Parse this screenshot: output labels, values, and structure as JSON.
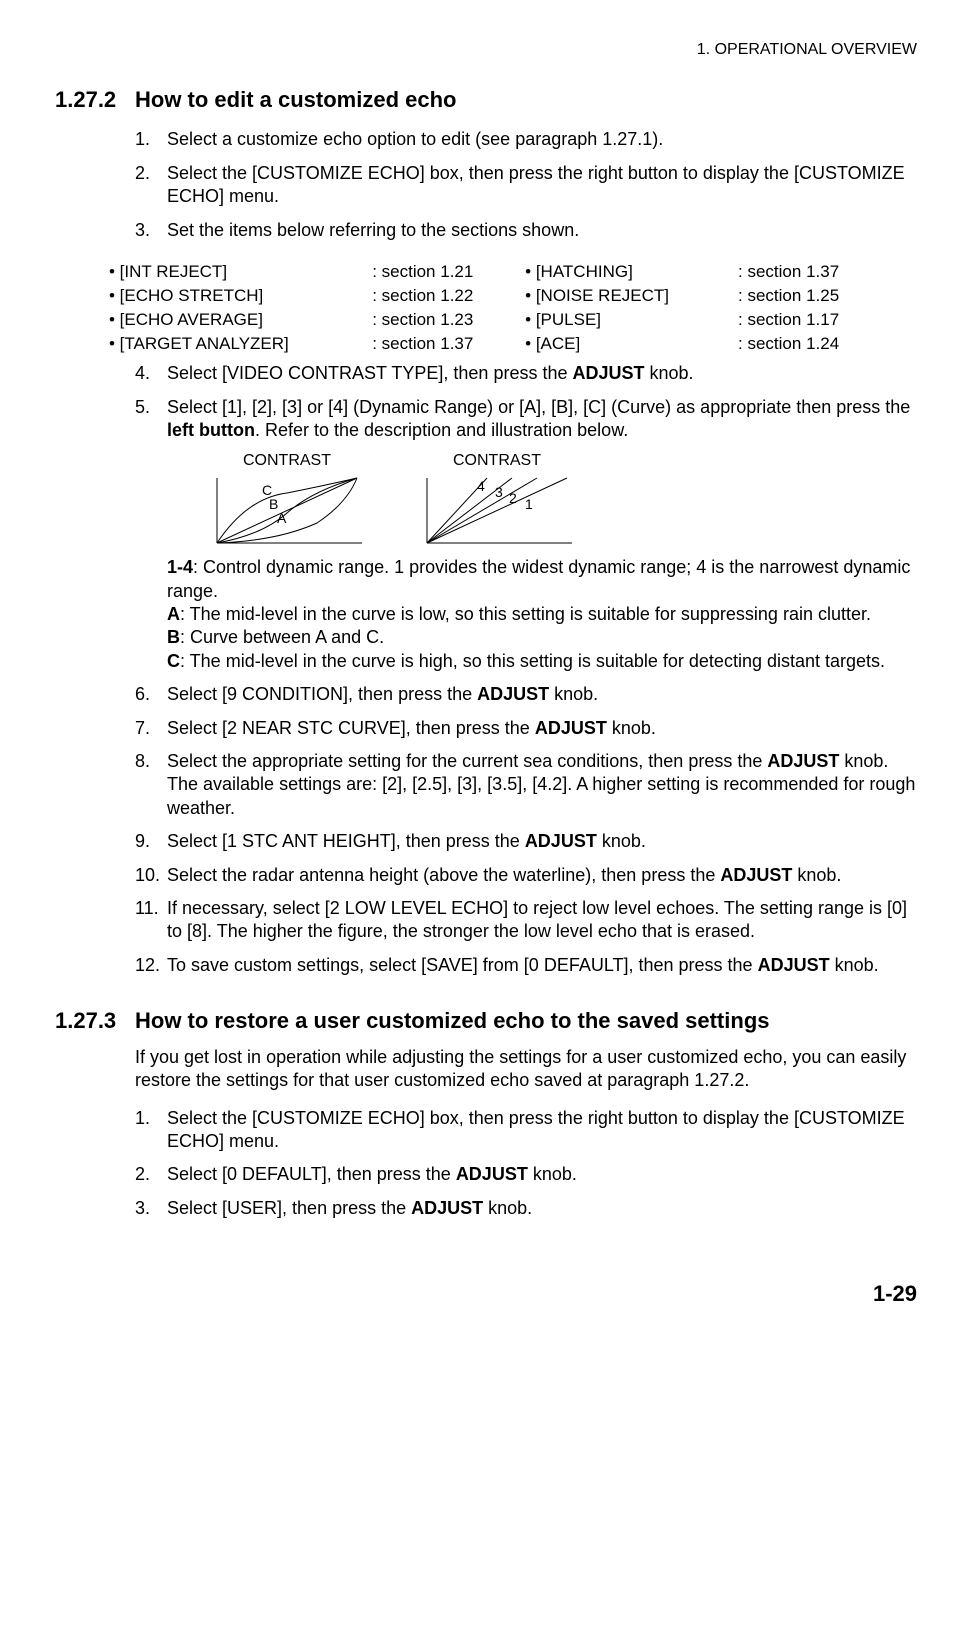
{
  "header": "1.  OPERATIONAL OVERVIEW",
  "s1": {
    "num": "1.27.2",
    "title": "How to edit a customized echo",
    "step1": "Select a customize echo option to edit (see paragraph 1.27.1).",
    "step2": "Select the [CUSTOMIZE ECHO] box, then press the right button to display the [CUSTOMIZE ECHO] menu.",
    "step3": "Set the items below referring to the sections shown.",
    "refs": {
      "l1a": "• [INT REJECT]",
      "l1b": ": section 1.21",
      "l1c": "• [HATCHING]",
      "l1d": ": section 1.37",
      "l2a": "• [ECHO STRETCH]",
      "l2b": ": section 1.22",
      "l2c": "• [NOISE REJECT]",
      "l2d": ": section 1.25",
      "l3a": "• [ECHO AVERAGE]",
      "l3b": ": section 1.23",
      "l3c": "• [PULSE]",
      "l3d": ": section 1.17",
      "l4a": "• [TARGET ANALYZER]",
      "l4b": ": section 1.37",
      "l4c": "• [ACE]",
      "l4d": ": section 1.24"
    },
    "step4a": "Select [VIDEO CONTRAST TYPE], then press the ",
    "step4b": "ADJUST",
    "step4c": " knob.",
    "step5a": "Select [1], [2], [3] or [4] (Dynamic Range) or [A], [B], [C] (Curve) as appropriate then press the ",
    "step5b": "left button",
    "step5c": ". Refer to the description and illustration below.",
    "diagLabel": "CONTRAST",
    "dA": "A",
    "dB": "B",
    "dC": "C",
    "d1": "1",
    "d2": "2",
    "d3": "3",
    "d4": "4",
    "desc14a": "1-4",
    "desc14b": ": Control dynamic range. 1 provides the widest dynamic range; 4 is the narrowest dynamic range.",
    "descAa": "A",
    "descAb": ": The mid-level in the curve is low, so this setting is suitable for suppressing rain clutter.",
    "descBa": "B",
    "descBb": ": Curve between A and C.",
    "descCa": "C",
    "descCb": ": The mid-level in the curve is high, so this setting is suitable for detecting distant targets.",
    "step6a": "Select [9 CONDITION], then press the ",
    "step6b": "ADJUST",
    "step6c": " knob.",
    "step7a": "Select [2 NEAR STC CURVE], then press the ",
    "step7b": "ADJUST",
    "step7c": " knob.",
    "step8a": "Select the appropriate setting for the current sea conditions, then press the ",
    "step8b": "ADJUST",
    "step8c": " knob. The available settings are: [2], [2.5], [3], [3.5], [4.2]. A higher setting is recommended for rough weather.",
    "step9a": "Select [1 STC ANT HEIGHT], then press the ",
    "step9b": "ADJUST",
    "step9c": " knob.",
    "step10a": "Select the radar antenna height (above the waterline), then press the ",
    "step10b": "ADJUST",
    "step10c": " knob.",
    "step11": "If necessary, select [2 LOW LEVEL ECHO] to reject low level echoes. The setting range is [0] to [8]. The higher the figure, the stronger the low level echo that is erased.",
    "step12a": "To save custom settings, select [SAVE] from [0 DEFAULT], then press the ",
    "step12b": "ADJUST",
    "step12c": " knob."
  },
  "s2": {
    "num": "1.27.3",
    "title": "How to restore a user customized echo to the saved settings",
    "intro": "If you get lost in operation while adjusting the settings for a user customized echo, you can easily restore the settings for that user customized echo saved at paragraph 1.27.2.",
    "step1": "Select the [CUSTOMIZE ECHO] box, then press the right button to display the [CUSTOMIZE ECHO] menu.",
    "step2a": "Select [0 DEFAULT], then press the ",
    "step2b": "ADJUST",
    "step2c": " knob.",
    "step3a": "Select [USER], then press the ",
    "step3b": "ADJUST",
    "step3c": " knob."
  },
  "footer": "1-29"
}
